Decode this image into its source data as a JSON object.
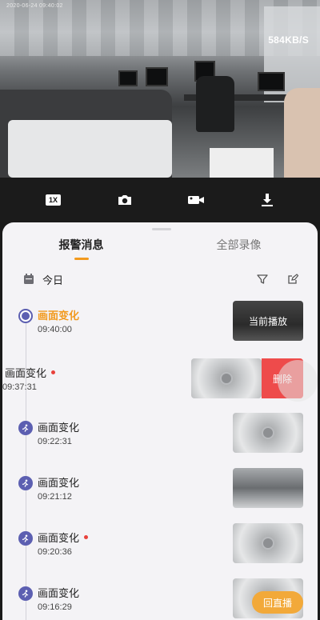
{
  "video": {
    "timestamp": "2020-06-24 09:40:02",
    "speed": "584KB/S"
  },
  "toolbar": {
    "speed_label": "1X",
    "icons": [
      "speed-1x",
      "camera-icon",
      "video-record-icon",
      "download-icon"
    ]
  },
  "tabs": [
    {
      "label": "报警消息",
      "active": true
    },
    {
      "label": "全部录像",
      "active": false
    }
  ],
  "date_bar": {
    "label": "今日",
    "icons": [
      "calendar-icon",
      "filter-icon",
      "edit-icon"
    ]
  },
  "events": [
    {
      "title": "画面变化",
      "time": "09:40:00",
      "current": true,
      "thumb_label": "当前播放",
      "unread": false
    },
    {
      "title": "画面变化",
      "time": "09:37:31",
      "swiped": true,
      "unread": true,
      "delete_label": "删除"
    },
    {
      "title": "画面变化",
      "time": "09:22:31",
      "unread": false
    },
    {
      "title": "画面变化",
      "time": "09:21:12",
      "unread": false
    },
    {
      "title": "画面变化",
      "time": "09:20:36",
      "unread": true
    },
    {
      "title": "画面变化",
      "time": "09:16:29",
      "unread": false
    }
  ],
  "live_button": "回直播",
  "colors": {
    "accent": "#f29a1e",
    "event_dot": "#5c5fb1",
    "delete": "#ee4b4b",
    "live_button": "#f2a93a"
  }
}
